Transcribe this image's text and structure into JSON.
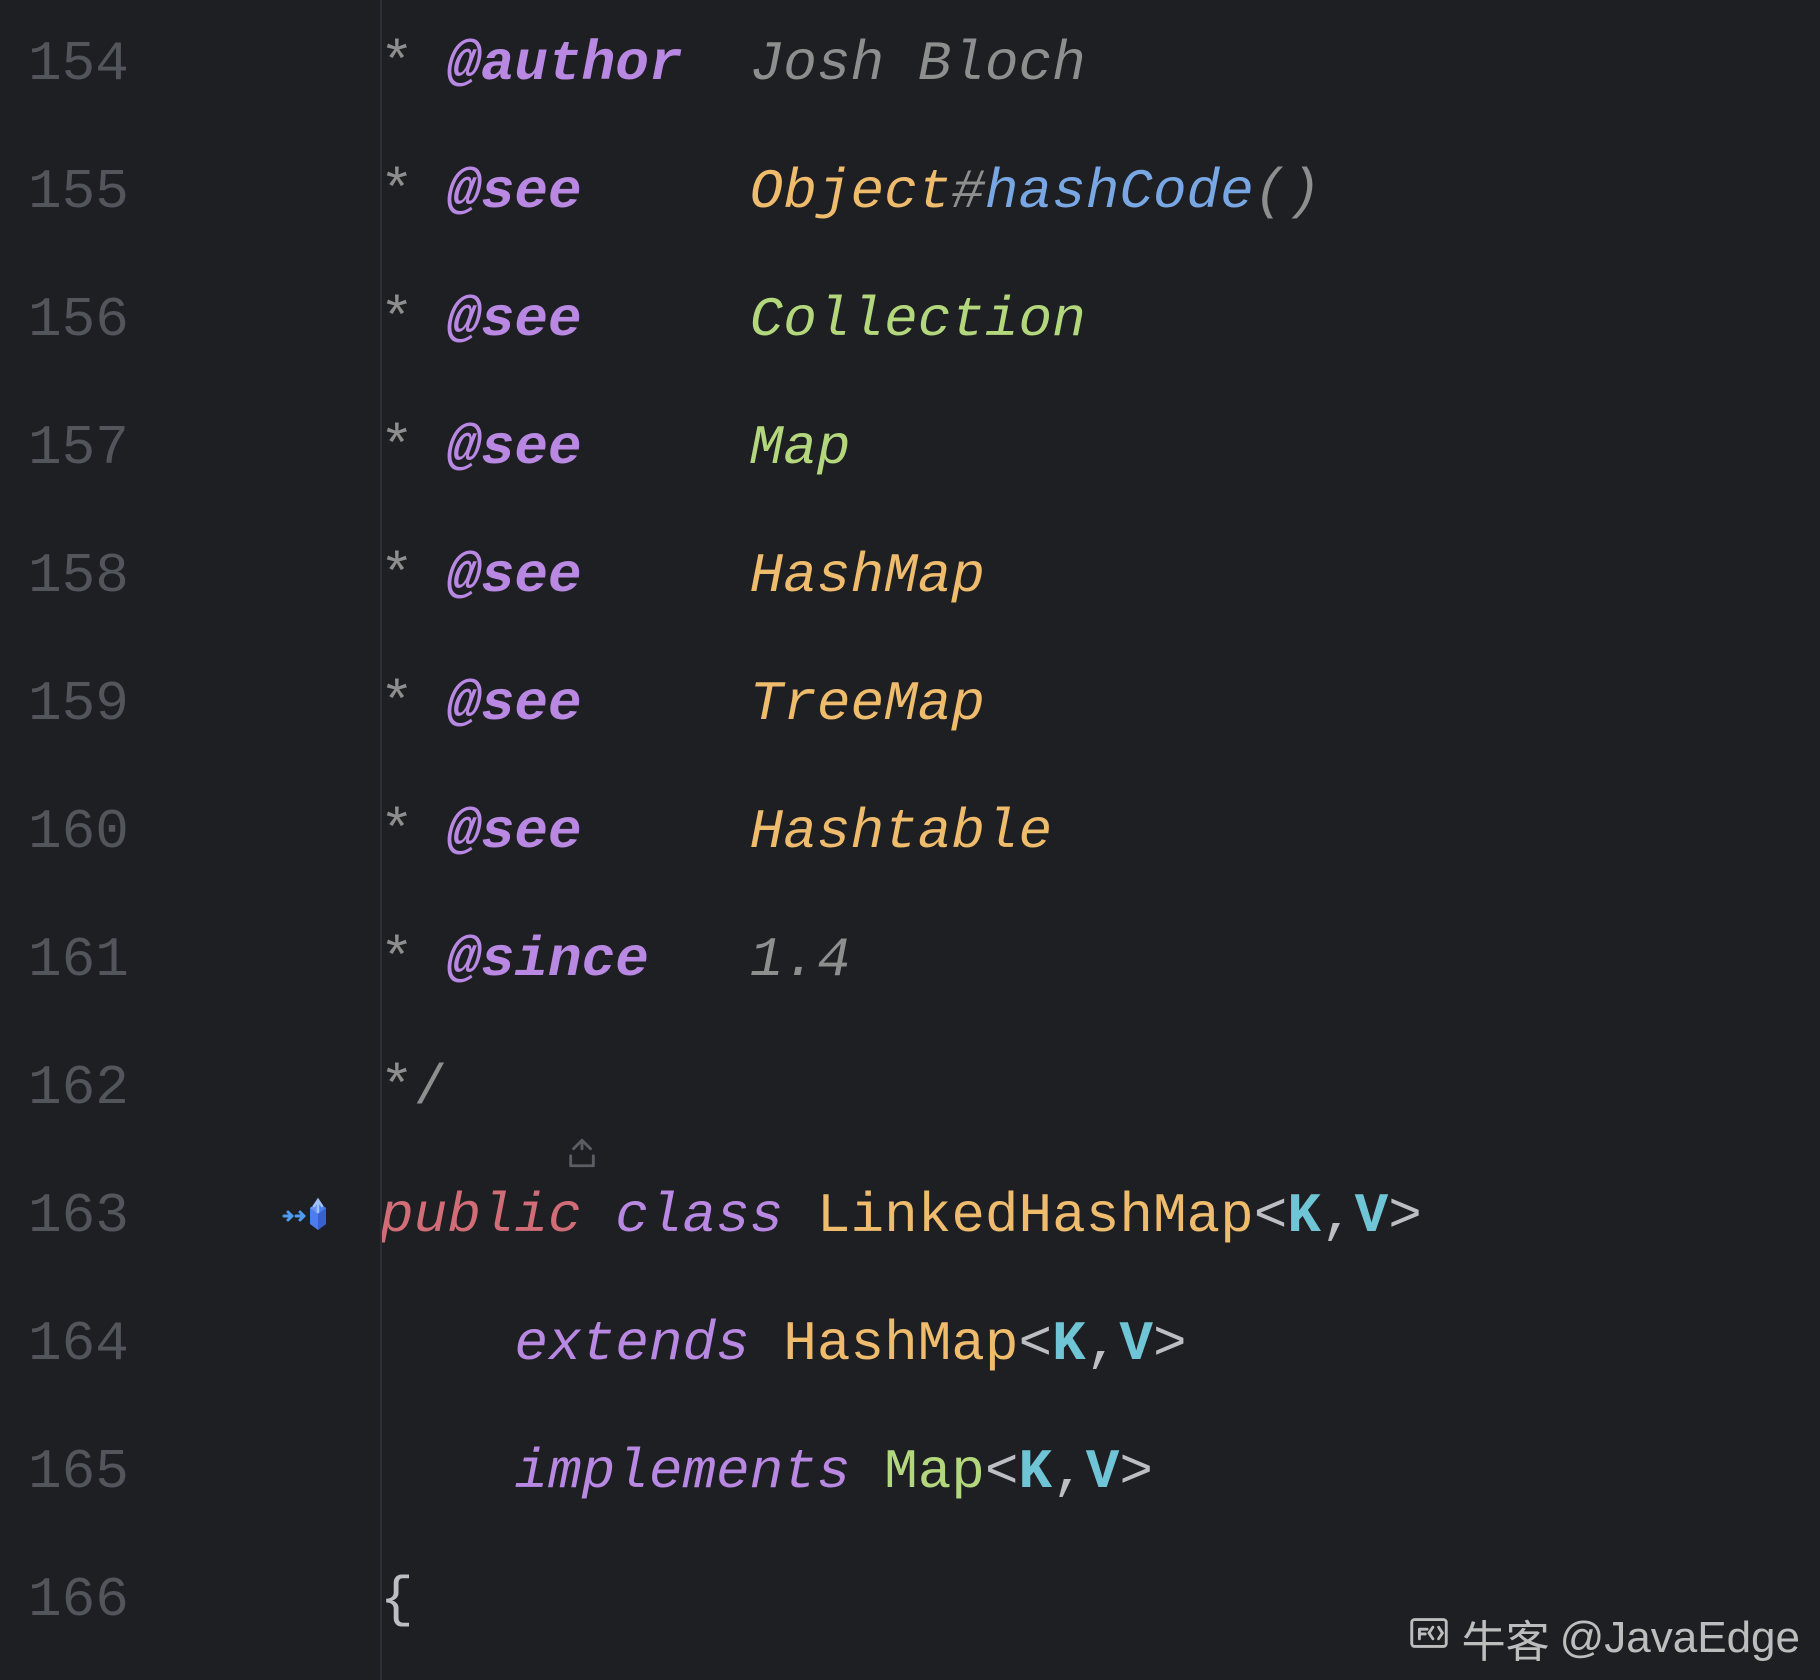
{
  "lines": [
    {
      "num": "154",
      "star": "* ",
      "tag": "@author",
      "gap": "  ",
      "tokens": [
        {
          "cls": "c-author",
          "t": "Josh Bloch"
        }
      ]
    },
    {
      "num": "155",
      "star": "* ",
      "tag": "@see",
      "gap": "     ",
      "tokens": [
        {
          "cls": "c-type",
          "t": "Object"
        },
        {
          "cls": "c-hash",
          "t": "#"
        },
        {
          "cls": "c-method",
          "t": "hashCode"
        },
        {
          "cls": "c-paren",
          "t": "()"
        }
      ]
    },
    {
      "num": "156",
      "star": "* ",
      "tag": "@see",
      "gap": "     ",
      "tokens": [
        {
          "cls": "c-green",
          "t": "Collection"
        }
      ]
    },
    {
      "num": "157",
      "star": "* ",
      "tag": "@see",
      "gap": "     ",
      "tokens": [
        {
          "cls": "c-green",
          "t": "Map"
        }
      ]
    },
    {
      "num": "158",
      "star": "* ",
      "tag": "@see",
      "gap": "     ",
      "tokens": [
        {
          "cls": "c-type",
          "t": "HashMap"
        }
      ]
    },
    {
      "num": "159",
      "star": "* ",
      "tag": "@see",
      "gap": "     ",
      "tokens": [
        {
          "cls": "c-type",
          "t": "TreeMap"
        }
      ]
    },
    {
      "num": "160",
      "star": "* ",
      "tag": "@see",
      "gap": "     ",
      "tokens": [
        {
          "cls": "c-type",
          "t": "Hashtable"
        }
      ]
    },
    {
      "num": "161",
      "star": "* ",
      "tag": "@since",
      "gap": "   ",
      "tokens": [
        {
          "cls": "c-author",
          "t": "1.4"
        }
      ]
    }
  ],
  "closeComment": {
    "num": "162",
    "text": "*/"
  },
  "decl": {
    "l163": {
      "num": "163",
      "tokens": [
        {
          "cls": "c-kw",
          "t": "public "
        },
        {
          "cls": "c-kw2",
          "t": "class "
        },
        {
          "cls": "c-class",
          "t": "LinkedHashMap"
        },
        {
          "cls": "c-angle",
          "t": "<"
        },
        {
          "cls": "c-param",
          "t": "K"
        },
        {
          "cls": "c-angle",
          "t": ","
        },
        {
          "cls": "c-param",
          "t": "V"
        },
        {
          "cls": "c-angle",
          "t": ">"
        }
      ]
    },
    "l164": {
      "num": "164",
      "indent": "    ",
      "tokens": [
        {
          "cls": "c-ext",
          "t": "extends "
        },
        {
          "cls": "c-class",
          "t": "HashMap"
        },
        {
          "cls": "c-angle",
          "t": "<"
        },
        {
          "cls": "c-param",
          "t": "K"
        },
        {
          "cls": "c-angle",
          "t": ","
        },
        {
          "cls": "c-param",
          "t": "V"
        },
        {
          "cls": "c-angle",
          "t": ">"
        }
      ]
    },
    "l165": {
      "num": "165",
      "indent": "    ",
      "tokens": [
        {
          "cls": "c-ext",
          "t": "implements "
        },
        {
          "cls": "c-intf",
          "t": "Map"
        },
        {
          "cls": "c-angle",
          "t": "<"
        },
        {
          "cls": "c-param",
          "t": "K"
        },
        {
          "cls": "c-angle",
          "t": ","
        },
        {
          "cls": "c-param",
          "t": "V"
        },
        {
          "cls": "c-angle",
          "t": ">"
        }
      ]
    },
    "l166": {
      "num": "166",
      "brace": "{"
    }
  },
  "watermark": {
    "site": "牛客",
    "handle": "@JavaEdge"
  }
}
